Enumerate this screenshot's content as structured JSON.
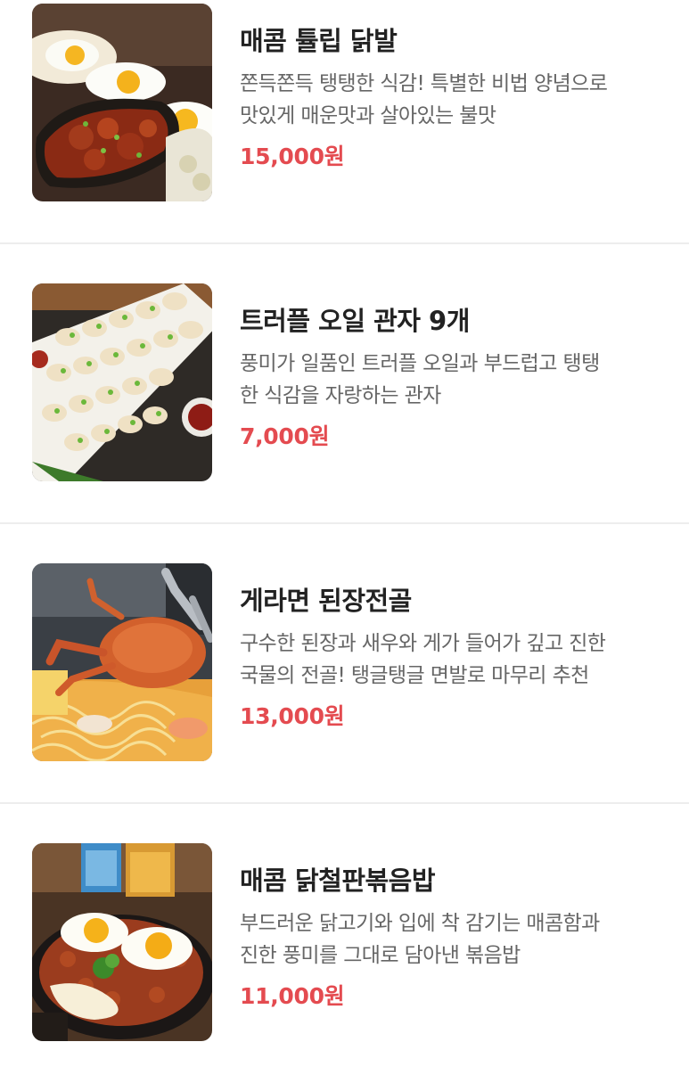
{
  "menu": {
    "items": [
      {
        "name": "매콤 튤립 닭발",
        "desc_line1": "쫀득쫀득 탱탱한 식감! 특별한 비법 양념으로",
        "desc_line2": "맛있게 매운맛과 살아있는 불맛",
        "price": "15,000원",
        "image": "spicy-chicken-feet-photo"
      },
      {
        "name": "트러플 오일 관자 9개",
        "desc_line1": "풍미가 일품인 트러플 오일과 부드럽고 탱탱",
        "desc_line2": "한 식감을 자랑하는 관자",
        "price": "7,000원",
        "image": "truffle-scallops-photo"
      },
      {
        "name": "게라면 된장전골",
        "desc_line1": "구수한 된장과 새우와 게가 들어가 깊고 진한",
        "desc_line2": "국물의 전골! 탱글탱글 면발로 마무리 추천",
        "price": "13,000원",
        "image": "crab-ramen-stew-photo"
      },
      {
        "name": "매콤 닭철판볶음밥",
        "desc_line1": "부드러운 닭고기와 입에 착 감기는 매콤함과",
        "desc_line2": "진한 풍미를 그대로 담아낸 볶음밥",
        "price": "11,000원",
        "image": "spicy-chicken-fried-rice-photo"
      }
    ]
  },
  "colors": {
    "price": "#e44b50",
    "title": "#222222",
    "description": "#666666",
    "divider": "#ededed"
  }
}
